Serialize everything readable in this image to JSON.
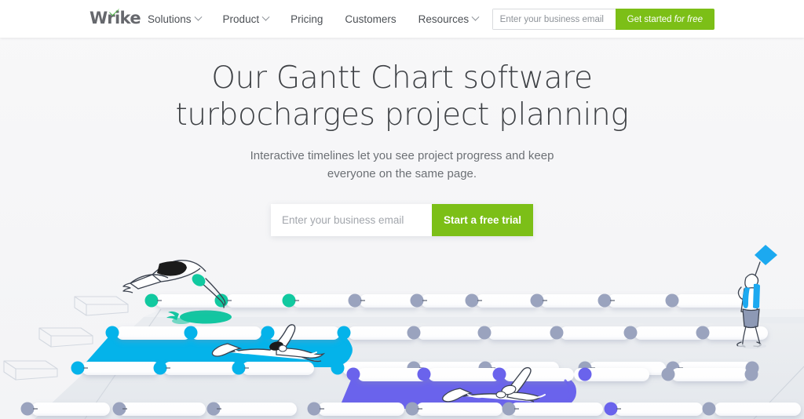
{
  "header": {
    "logo_text": "Wrike",
    "logo_icon": "wrike-check-icon",
    "nav": [
      {
        "label": "Solutions",
        "has_caret": true
      },
      {
        "label": "Product",
        "has_caret": true
      },
      {
        "label": "Pricing",
        "has_caret": false
      },
      {
        "label": "Customers",
        "has_caret": false
      },
      {
        "label": "Resources",
        "has_caret": true
      }
    ],
    "email_placeholder": "Enter your business email",
    "email_value": "",
    "cta_label": "Get started",
    "cta_label_italic": "for free"
  },
  "hero": {
    "title_line1": "Our Gantt Chart software",
    "title_line2": "turbocharges project planning",
    "subtitle_line1": "Interactive timelines let you see project progress and keep",
    "subtitle_line2": "everyone on the same page.",
    "email_placeholder": "Enter your business email",
    "email_value": "",
    "cta_label": "Start a free trial"
  },
  "illustration": {
    "name": "swimming-pool-gantt-illustration",
    "alt": "Isometric swimming pool with lanes styled as Gantt chart bars, a diver, two swimmers and a spectator holding a blue flag",
    "colors": {
      "green": "#11c9a0",
      "cyan": "#04b3ea",
      "purple": "#6a63ec",
      "gray": "#9aa3be",
      "bar_fill": "#ffffff",
      "deck": "#e4e8ec"
    },
    "figures": [
      {
        "name": "diver",
        "cap_color": "#11c9a0",
        "trunks_color": "#1b1b1b"
      },
      {
        "name": "swimmer-cyan-lane",
        "lane_color": "#04b3ea"
      },
      {
        "name": "swimmer-purple-lane",
        "lane_color": "#6a63ec"
      },
      {
        "name": "spectator-with-flag",
        "flag_color": "#1ca9f0",
        "towel_color": "#1ca9f0",
        "shorts_color": "#8d99b5"
      }
    ],
    "rows": [
      {
        "index": 0,
        "accent": "#11c9a0"
      },
      {
        "index": 1,
        "accent": "#9aa3be"
      },
      {
        "index": 2,
        "accent": "#04b3ea"
      },
      {
        "index": 3,
        "accent": "#9aa3be"
      },
      {
        "index": 4,
        "accent": "#6a63ec"
      },
      {
        "index": 5,
        "accent": "#9aa3be"
      }
    ]
  },
  "theme": {
    "brand_green": "#7cbf17",
    "page_bg": "#f7f7f8",
    "header_bg": "#ffffff",
    "heading_color": "#3f4246",
    "body_color": "#6c7075"
  }
}
